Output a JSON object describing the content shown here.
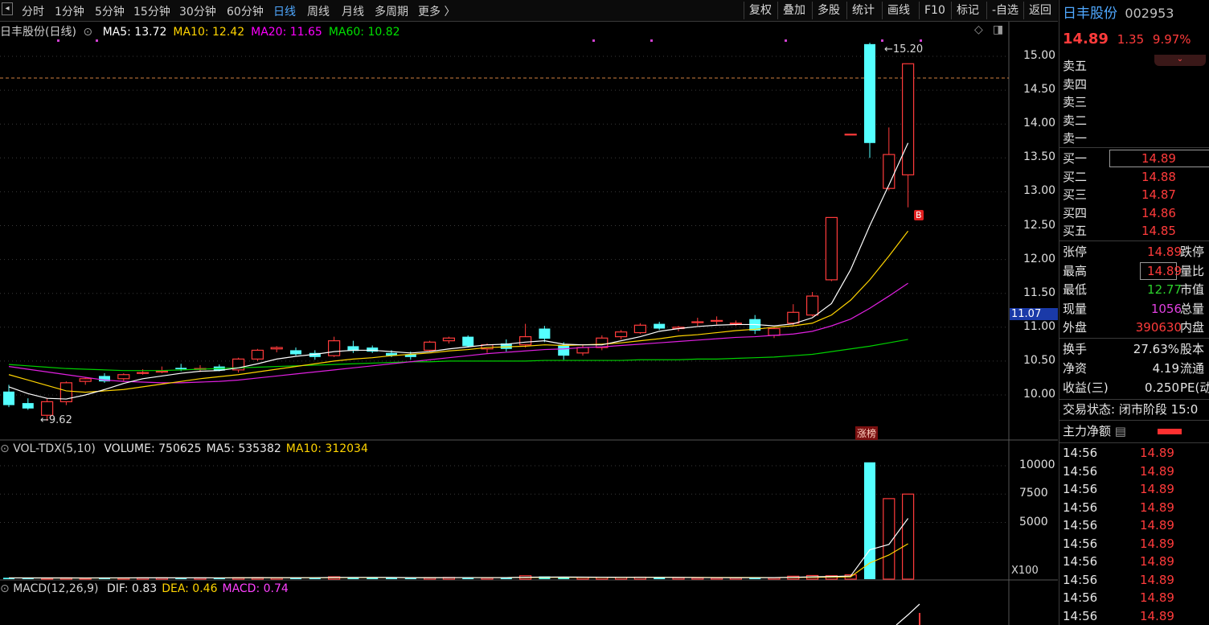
{
  "toolbar": {
    "periods": [
      "分时",
      "1分钟",
      "5分钟",
      "15分钟",
      "30分钟",
      "60分钟",
      "日线",
      "周线",
      "月线",
      "多周期",
      "更多 〉"
    ],
    "active_period": "日线",
    "buttons": [
      "复权",
      "叠加",
      "多股",
      "统计",
      "画线",
      "F10",
      "标记",
      "-自选",
      "返回"
    ]
  },
  "main_chart": {
    "title": "日丰股份(日线)",
    "ma_labels": [
      {
        "text": "MA5: 13.72",
        "color": "#ffffff"
      },
      {
        "text": "MA10: 12.42",
        "color": "#ffd400"
      },
      {
        "text": "MA20: 11.65",
        "color": "#ff00ff"
      },
      {
        "text": "MA60: 10.82",
        "color": "#00e000"
      }
    ],
    "high_marker": "15.20",
    "low_marker": "9.62",
    "limit_badge": "涨榜",
    "b_badge": "B",
    "crosshair_price": "11.07",
    "y_axis": [
      "15.00",
      "14.50",
      "14.00",
      "13.50",
      "13.00",
      "12.50",
      "12.00",
      "11.50",
      "11.00",
      "10.50",
      "10.00"
    ]
  },
  "chart_data": {
    "type": "candlestick",
    "ylim": [
      9.5,
      15.4
    ],
    "candles": [
      {
        "o": 10.05,
        "h": 10.15,
        "l": 9.82,
        "c": 9.85
      },
      {
        "o": 9.88,
        "h": 9.95,
        "l": 9.78,
        "c": 9.8
      },
      {
        "o": 9.7,
        "h": 9.95,
        "l": 9.62,
        "c": 9.9
      },
      {
        "o": 9.9,
        "h": 10.2,
        "l": 9.85,
        "c": 10.18
      },
      {
        "o": 10.2,
        "h": 10.26,
        "l": 10.15,
        "c": 10.24
      },
      {
        "o": 10.28,
        "h": 10.32,
        "l": 10.18,
        "c": 10.2
      },
      {
        "o": 10.24,
        "h": 10.32,
        "l": 10.2,
        "c": 10.3
      },
      {
        "o": 10.32,
        "h": 10.38,
        "l": 10.3,
        "c": 10.33
      },
      {
        "o": 10.34,
        "h": 10.42,
        "l": 10.32,
        "c": 10.35
      },
      {
        "o": 10.4,
        "h": 10.46,
        "l": 10.35,
        "c": 10.38
      },
      {
        "o": 10.38,
        "h": 10.44,
        "l": 10.34,
        "c": 10.39
      },
      {
        "o": 10.42,
        "h": 10.45,
        "l": 10.35,
        "c": 10.36
      },
      {
        "o": 10.37,
        "h": 10.55,
        "l": 10.33,
        "c": 10.53
      },
      {
        "o": 10.53,
        "h": 10.68,
        "l": 10.5,
        "c": 10.66
      },
      {
        "o": 10.68,
        "h": 10.72,
        "l": 10.63,
        "c": 10.7
      },
      {
        "o": 10.66,
        "h": 10.7,
        "l": 10.58,
        "c": 10.6
      },
      {
        "o": 10.62,
        "h": 10.66,
        "l": 10.52,
        "c": 10.56
      },
      {
        "o": 10.58,
        "h": 10.86,
        "l": 10.56,
        "c": 10.8
      },
      {
        "o": 10.72,
        "h": 10.8,
        "l": 10.62,
        "c": 10.65
      },
      {
        "o": 10.7,
        "h": 10.73,
        "l": 10.62,
        "c": 10.64
      },
      {
        "o": 10.62,
        "h": 10.66,
        "l": 10.56,
        "c": 10.58
      },
      {
        "o": 10.6,
        "h": 10.64,
        "l": 10.52,
        "c": 10.56
      },
      {
        "o": 10.66,
        "h": 10.8,
        "l": 10.64,
        "c": 10.78
      },
      {
        "o": 10.8,
        "h": 10.86,
        "l": 10.76,
        "c": 10.84
      },
      {
        "o": 10.86,
        "h": 10.88,
        "l": 10.7,
        "c": 10.72
      },
      {
        "o": 10.68,
        "h": 10.76,
        "l": 10.62,
        "c": 10.74
      },
      {
        "o": 10.76,
        "h": 10.82,
        "l": 10.64,
        "c": 10.68
      },
      {
        "o": 10.74,
        "h": 11.05,
        "l": 10.7,
        "c": 10.86
      },
      {
        "o": 10.98,
        "h": 11.02,
        "l": 10.78,
        "c": 10.83
      },
      {
        "o": 10.74,
        "h": 10.78,
        "l": 10.52,
        "c": 10.58
      },
      {
        "o": 10.62,
        "h": 10.74,
        "l": 10.58,
        "c": 10.7
      },
      {
        "o": 10.7,
        "h": 10.88,
        "l": 10.66,
        "c": 10.84
      },
      {
        "o": 10.86,
        "h": 10.96,
        "l": 10.82,
        "c": 10.93
      },
      {
        "o": 10.92,
        "h": 11.06,
        "l": 10.9,
        "c": 11.03
      },
      {
        "o": 11.05,
        "h": 11.08,
        "l": 10.96,
        "c": 10.98
      },
      {
        "o": 10.98,
        "h": 11.02,
        "l": 10.94,
        "c": 11.0
      },
      {
        "o": 11.08,
        "h": 11.14,
        "l": 11.02,
        "c": 11.08
      },
      {
        "o": 11.1,
        "h": 11.16,
        "l": 11.04,
        "c": 11.1
      },
      {
        "o": 11.06,
        "h": 11.1,
        "l": 11.02,
        "c": 11.06
      },
      {
        "o": 11.12,
        "h": 11.18,
        "l": 10.9,
        "c": 10.95
      },
      {
        "o": 10.88,
        "h": 11.0,
        "l": 10.84,
        "c": 10.98
      },
      {
        "o": 11.06,
        "h": 11.34,
        "l": 11.02,
        "c": 11.22
      },
      {
        "o": 11.18,
        "h": 11.52,
        "l": 11.16,
        "c": 11.46
      },
      {
        "o": 11.7,
        "h": 12.62,
        "l": 11.68,
        "c": 12.62
      },
      {
        "o": 13.85,
        "h": 13.85,
        "l": 13.85,
        "c": 13.85
      },
      {
        "o": 15.18,
        "h": 15.2,
        "l": 13.5,
        "c": 13.72
      },
      {
        "o": 13.05,
        "h": 13.95,
        "l": 13.02,
        "c": 13.55
      },
      {
        "o": 13.25,
        "h": 14.89,
        "l": 12.77,
        "c": 14.89
      }
    ],
    "ma5": [
      10.12,
      10.02,
      9.95,
      9.94,
      10.0,
      10.08,
      10.17,
      10.24,
      10.28,
      10.32,
      10.35,
      10.36,
      10.4,
      10.46,
      10.53,
      10.57,
      10.6,
      10.64,
      10.66,
      10.66,
      10.64,
      10.62,
      10.64,
      10.68,
      10.71,
      10.74,
      10.75,
      10.78,
      10.8,
      10.75,
      10.74,
      10.74,
      10.8,
      10.86,
      10.94,
      10.98,
      11.01,
      11.03,
      11.04,
      11.04,
      11.02,
      11.05,
      11.14,
      11.35,
      11.85,
      12.5,
      13.1,
      13.72
    ],
    "ma10": [
      10.3,
      10.22,
      10.14,
      10.06,
      10.04,
      10.06,
      10.08,
      10.12,
      10.16,
      10.2,
      10.24,
      10.27,
      10.3,
      10.34,
      10.38,
      10.42,
      10.46,
      10.5,
      10.53,
      10.55,
      10.58,
      10.6,
      10.62,
      10.65,
      10.67,
      10.7,
      10.71,
      10.72,
      10.74,
      10.73,
      10.74,
      10.75,
      10.77,
      10.8,
      10.83,
      10.87,
      10.89,
      10.92,
      10.95,
      10.97,
      11.0,
      11.02,
      11.06,
      11.18,
      11.4,
      11.7,
      12.05,
      12.42
    ],
    "ma20": [
      10.42,
      10.38,
      10.34,
      10.3,
      10.26,
      10.22,
      10.2,
      10.19,
      10.18,
      10.18,
      10.19,
      10.2,
      10.22,
      10.25,
      10.28,
      10.31,
      10.34,
      10.37,
      10.4,
      10.43,
      10.46,
      10.49,
      10.52,
      10.55,
      10.58,
      10.61,
      10.63,
      10.65,
      10.67,
      10.68,
      10.7,
      10.71,
      10.73,
      10.75,
      10.77,
      10.79,
      10.81,
      10.83,
      10.85,
      10.86,
      10.88,
      10.9,
      10.94,
      11.02,
      11.12,
      11.28,
      11.46,
      11.65
    ],
    "ma60": [
      10.45,
      10.43,
      10.41,
      10.39,
      10.38,
      10.37,
      10.36,
      10.36,
      10.36,
      10.37,
      10.38,
      10.39,
      10.4,
      10.41,
      10.42,
      10.43,
      10.44,
      10.45,
      10.46,
      10.47,
      10.48,
      10.49,
      10.49,
      10.5,
      10.5,
      10.5,
      10.5,
      10.5,
      10.51,
      10.51,
      10.51,
      10.51,
      10.51,
      10.52,
      10.52,
      10.52,
      10.53,
      10.53,
      10.54,
      10.55,
      10.56,
      10.58,
      10.6,
      10.64,
      10.68,
      10.72,
      10.77,
      10.82
    ],
    "volume": [
      120,
      90,
      100,
      110,
      95,
      130,
      105,
      115,
      120,
      100,
      110,
      105,
      130,
      140,
      125,
      120,
      135,
      210,
      150,
      120,
      110,
      100,
      140,
      150,
      130,
      120,
      125,
      300,
      240,
      160,
      150,
      170,
      160,
      175,
      140,
      130,
      120,
      110,
      120,
      150,
      130,
      260,
      320,
      300,
      380,
      10300,
      7100,
      7500
    ],
    "vol_ma5": [
      110,
      108,
      105,
      106,
      103,
      110,
      112,
      115,
      117,
      115,
      114,
      112,
      118,
      124,
      127,
      126,
      130,
      150,
      156,
      155,
      150,
      132,
      124,
      134,
      136,
      130,
      133,
      170,
      180,
      186,
      176,
      174,
      164,
      162,
      156,
      150,
      138,
      127,
      124,
      129,
      132,
      165,
      205,
      230,
      277,
      2590,
      3060,
      5353
    ],
    "vol_ma10": [
      112,
      110,
      108,
      107,
      106,
      107,
      108,
      110,
      111,
      112,
      112,
      112,
      114,
      117,
      119,
      120,
      122,
      132,
      139,
      140,
      139,
      135,
      133,
      136,
      137,
      138,
      138,
      148,
      158,
      162,
      160,
      162,
      160,
      164,
      160,
      155,
      150,
      146,
      143,
      141,
      139,
      150,
      165,
      180,
      205,
      1428,
      2130,
      3120
    ],
    "vol_ylim": [
      0,
      10300
    ]
  },
  "volume_panel": {
    "title": "VOL-TDX(5,10)",
    "labels": [
      {
        "text": "VOLUME: 750625",
        "color": "#e6e6e6"
      },
      {
        "text": "MA5: 535382",
        "color": "#e6e6e6"
      },
      {
        "text": "MA10: 312034",
        "color": "#ffd400"
      }
    ],
    "y_axis": [
      "10000",
      "7500",
      "5000"
    ],
    "unit": "X100"
  },
  "macd_panel": {
    "title": "MACD(12,26,9)",
    "labels": [
      {
        "text": "DIF: 0.83",
        "color": "#e6e6e6"
      },
      {
        "text": "DEA: 0.46",
        "color": "#ffd400"
      },
      {
        "text": "MACD: 0.74",
        "color": "#ff40ff"
      }
    ]
  },
  "panel": {
    "name": "日丰股份",
    "code": "002953",
    "price": "14.89",
    "change": "1.35",
    "pct": "9.97%",
    "asks": [
      {
        "label": "卖五",
        "price": "",
        "vol": ""
      },
      {
        "label": "卖四",
        "price": "",
        "vol": ""
      },
      {
        "label": "卖三",
        "price": "",
        "vol": ""
      },
      {
        "label": "卖二",
        "price": "",
        "vol": ""
      },
      {
        "label": "卖一",
        "price": "",
        "vol": ""
      }
    ],
    "bids": [
      {
        "label": "买一",
        "price": "14.89"
      },
      {
        "label": "买二",
        "price": "14.88"
      },
      {
        "label": "买三",
        "price": "14.87"
      },
      {
        "label": "买四",
        "price": "14.86"
      },
      {
        "label": "买五",
        "price": "14.85"
      }
    ],
    "stats": [
      {
        "label": "张停",
        "value": "14.89",
        "color": "#ff3b3b",
        "tail": "跌停"
      },
      {
        "label": "最高",
        "value": "14.89",
        "color": "#ff3b3b",
        "tail": "量比"
      },
      {
        "label": "最低",
        "value": "12.77",
        "color": "#2cd12c",
        "tail": "市值"
      },
      {
        "label": "现量",
        "value": "1056",
        "color": "#e040e0",
        "tail": "总量"
      },
      {
        "label": "外盘",
        "value": "390630",
        "color": "#ff3b3b",
        "tail": "内盘"
      }
    ],
    "stats2": [
      {
        "label": "换手",
        "value": "27.63%",
        "tail": "股本"
      },
      {
        "label": "净资",
        "value": "4.19",
        "tail": "流通"
      },
      {
        "label": "收益(三)",
        "value": "0.250",
        "tail": "PE(动"
      }
    ],
    "status": "交易状态: 闭市阶段 15:0",
    "net_flow": "主力净额",
    "ticks": [
      {
        "time": "14:56",
        "price": "14.89"
      },
      {
        "time": "14:56",
        "price": "14.89"
      },
      {
        "time": "14:56",
        "price": "14.89"
      },
      {
        "time": "14:56",
        "price": "14.89"
      },
      {
        "time": "14:56",
        "price": "14.89"
      },
      {
        "time": "14:56",
        "price": "14.89"
      },
      {
        "time": "14:56",
        "price": "14.89"
      },
      {
        "time": "14:56",
        "price": "14.89"
      },
      {
        "time": "14:56",
        "price": "14.89"
      },
      {
        "time": "14:56",
        "price": "14.89"
      }
    ]
  }
}
